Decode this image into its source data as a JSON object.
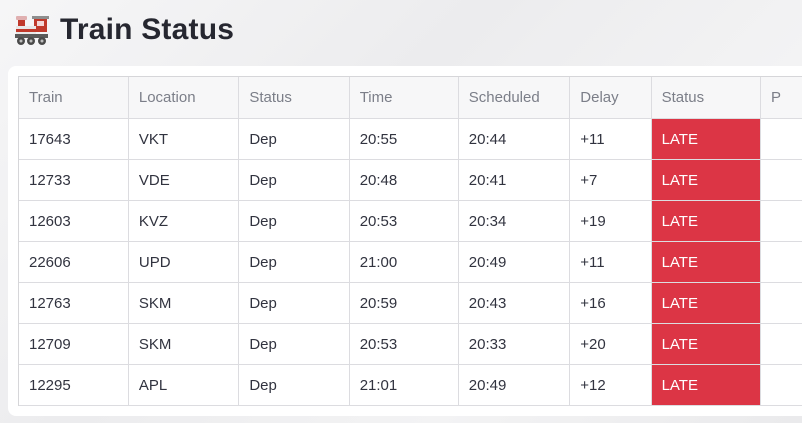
{
  "page": {
    "title": "Train Status"
  },
  "table": {
    "headers": [
      "Train",
      "Location",
      "Status",
      "Time",
      "Scheduled",
      "Delay",
      "Status",
      "P"
    ],
    "rows": [
      [
        "17643",
        "VKT",
        "Dep",
        "20:55",
        "20:44",
        "+11",
        "LATE",
        ""
      ],
      [
        "12733",
        "VDE",
        "Dep",
        "20:48",
        "20:41",
        "+7",
        "LATE",
        ""
      ],
      [
        "12603",
        "KVZ",
        "Dep",
        "20:53",
        "20:34",
        "+19",
        "LATE",
        ""
      ],
      [
        "22606",
        "UPD",
        "Dep",
        "21:00",
        "20:49",
        "+11",
        "LATE",
        ""
      ],
      [
        "12763",
        "SKM",
        "Dep",
        "20:59",
        "20:43",
        "+16",
        "LATE",
        ""
      ],
      [
        "12709",
        "SKM",
        "Dep",
        "20:53",
        "20:33",
        "+20",
        "LATE",
        ""
      ],
      [
        "12295",
        "APL",
        "Dep",
        "21:01",
        "20:49",
        "+12",
        "LATE",
        ""
      ]
    ]
  },
  "colors": {
    "late": "#dc3545",
    "header_bg": "#f7f7f8",
    "title": "#262730"
  },
  "icons": {
    "title_icon": "locomotive-icon"
  }
}
